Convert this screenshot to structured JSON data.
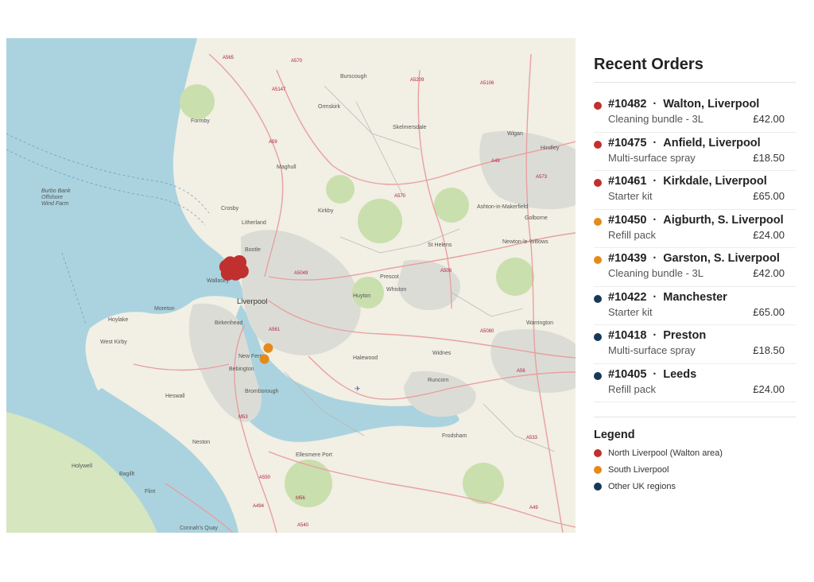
{
  "colors": {
    "north": "#c0302f",
    "south": "#e48a1b",
    "other": "#163a57",
    "sea": "#aad3df",
    "land": "#f2efe4",
    "urban": "#dcdcd6",
    "green": "#c9dfad"
  },
  "map": {
    "places": {
      "burscough": "Burscough",
      "ormskirk": "Ormskirk",
      "skelmersdale": "Skelmersdale",
      "formby": "Formby",
      "maghull": "Maghull",
      "wigan": "Wigan",
      "hindley": "Hindley",
      "crosby": "Crosby",
      "litherland": "Litherland",
      "kirkby": "Kirkby",
      "ashton": "Ashton-in-Makerfield",
      "golborne": "Golborne",
      "newton": "Newton-le-Willows",
      "sthelens": "St Helens",
      "bootle": "Bootle",
      "wallasey": "Wallasey",
      "prescot": "Prescot",
      "liverpool": "Liverpool",
      "huyton": "Huyton",
      "whiston": "Whiston",
      "moreton": "Moreton",
      "hoylake": "Hoylake",
      "birkenhead": "Birkenhead",
      "westkirby": "West Kirby",
      "warrington": "Warrington",
      "newferry": "New Ferry",
      "bebington": "Bebington",
      "halewood": "Halewood",
      "widnes": "Widnes",
      "heswall": "Heswall",
      "bromborough": "Bromborough",
      "runcorn": "Runcorn",
      "neston": "Neston",
      "ellesmere": "Ellesmere Port",
      "frodsham": "Frodsham",
      "holywell": "Holywell",
      "bagillt": "Bagillt",
      "flint": "Flint",
      "connahs": "Connah's Quay",
      "burbo1": "Burbo Bank",
      "burbo2": "Offshore",
      "burbo3": "Wind Farm"
    },
    "roads": [
      "A565",
      "A570",
      "A5147",
      "A5209",
      "A5106",
      "A59",
      "A49",
      "A573",
      "A570",
      "A5049",
      "A509",
      "A561",
      "A5080",
      "A56",
      "A533",
      "A550",
      "A494",
      "M56",
      "A540",
      "M53",
      "A49"
    ],
    "markers": [
      {
        "group": "north",
        "lon": -2.96,
        "lat": 53.442
      },
      {
        "group": "north",
        "lon": -2.955,
        "lat": 53.445
      },
      {
        "group": "north",
        "lon": -2.952,
        "lat": 53.439
      },
      {
        "group": "north",
        "lon": -2.945,
        "lat": 53.443
      },
      {
        "group": "north",
        "lon": -2.948,
        "lat": 53.436
      },
      {
        "group": "north",
        "lon": -2.94,
        "lat": 53.438
      },
      {
        "group": "north",
        "lon": -2.958,
        "lat": 53.436
      },
      {
        "group": "north",
        "lon": -2.943,
        "lat": 53.446
      },
      {
        "group": "south",
        "lon": -2.905,
        "lat": 53.368
      },
      {
        "group": "south",
        "lon": -2.91,
        "lat": 53.358
      }
    ]
  },
  "panel": {
    "title": "Recent Orders",
    "separator": "·",
    "orders": [
      {
        "id": "#10482",
        "area": "Walton, Liverpool",
        "item": "Cleaning bundle - 3L",
        "price": "£42.00",
        "group": "north"
      },
      {
        "id": "#10475",
        "area": "Anfield, Liverpool",
        "item": "Multi-surface spray",
        "price": "£18.50",
        "group": "north"
      },
      {
        "id": "#10461",
        "area": "Kirkdale, Liverpool",
        "item": "Starter kit",
        "price": "£65.00",
        "group": "north"
      },
      {
        "id": "#10450",
        "area": "Aigburth, S. Liverpool",
        "item": "Refill pack",
        "price": "£24.00",
        "group": "south"
      },
      {
        "id": "#10439",
        "area": "Garston, S. Liverpool",
        "item": "Cleaning bundle - 3L",
        "price": "£42.00",
        "group": "south"
      },
      {
        "id": "#10422",
        "area": "Manchester",
        "item": "Starter kit",
        "price": "£65.00",
        "group": "other"
      },
      {
        "id": "#10418",
        "area": "Preston",
        "item": "Multi-surface spray",
        "price": "£18.50",
        "group": "other"
      },
      {
        "id": "#10405",
        "area": "Leeds",
        "item": "Refill pack",
        "price": "£24.00",
        "group": "other"
      }
    ],
    "legend": {
      "title": "Legend",
      "items": [
        {
          "label": "North Liverpool (Walton area)",
          "group": "north"
        },
        {
          "label": "South Liverpool",
          "group": "south"
        },
        {
          "label": "Other UK regions",
          "group": "other"
        }
      ]
    }
  }
}
